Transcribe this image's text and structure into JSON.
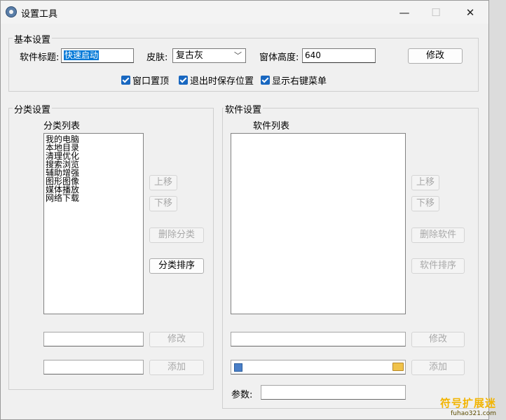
{
  "window": {
    "title": "设置工具",
    "minimize": "—",
    "maximize": "☐",
    "close": "✕"
  },
  "basic": {
    "title": "基本设置",
    "software_title_label": "软件标题:",
    "software_title_value": "快速启动",
    "skin_label": "皮肤:",
    "skin_value": "复古灰",
    "height_label": "窗体高度:",
    "height_value": "640",
    "modify_button": "修改",
    "checks": [
      {
        "label": "窗口置顶",
        "checked": true
      },
      {
        "label": "退出时保存位置",
        "checked": true
      },
      {
        "label": "显示右键菜单",
        "checked": true
      }
    ]
  },
  "category": {
    "title": "分类设置",
    "list_label": "分类列表",
    "items": [
      "我的电脑",
      "本地目录",
      "清理优化",
      "搜索浏览",
      "辅助增强",
      "图形图像",
      "媒体播放",
      "网络下载"
    ],
    "move_up": "上移",
    "move_down": "下移",
    "delete": "删除分类",
    "sort": "分类排序",
    "modify": "修改",
    "add": "添加"
  },
  "software": {
    "title": "软件设置",
    "list_label": "软件列表",
    "move_up": "上移",
    "move_down": "下移",
    "delete": "删除软件",
    "sort": "软件排序",
    "modify": "修改",
    "add": "添加",
    "params_label": "参数:"
  },
  "watermark": {
    "cn": "符号扩展迷",
    "en": "fuhao321.com"
  }
}
